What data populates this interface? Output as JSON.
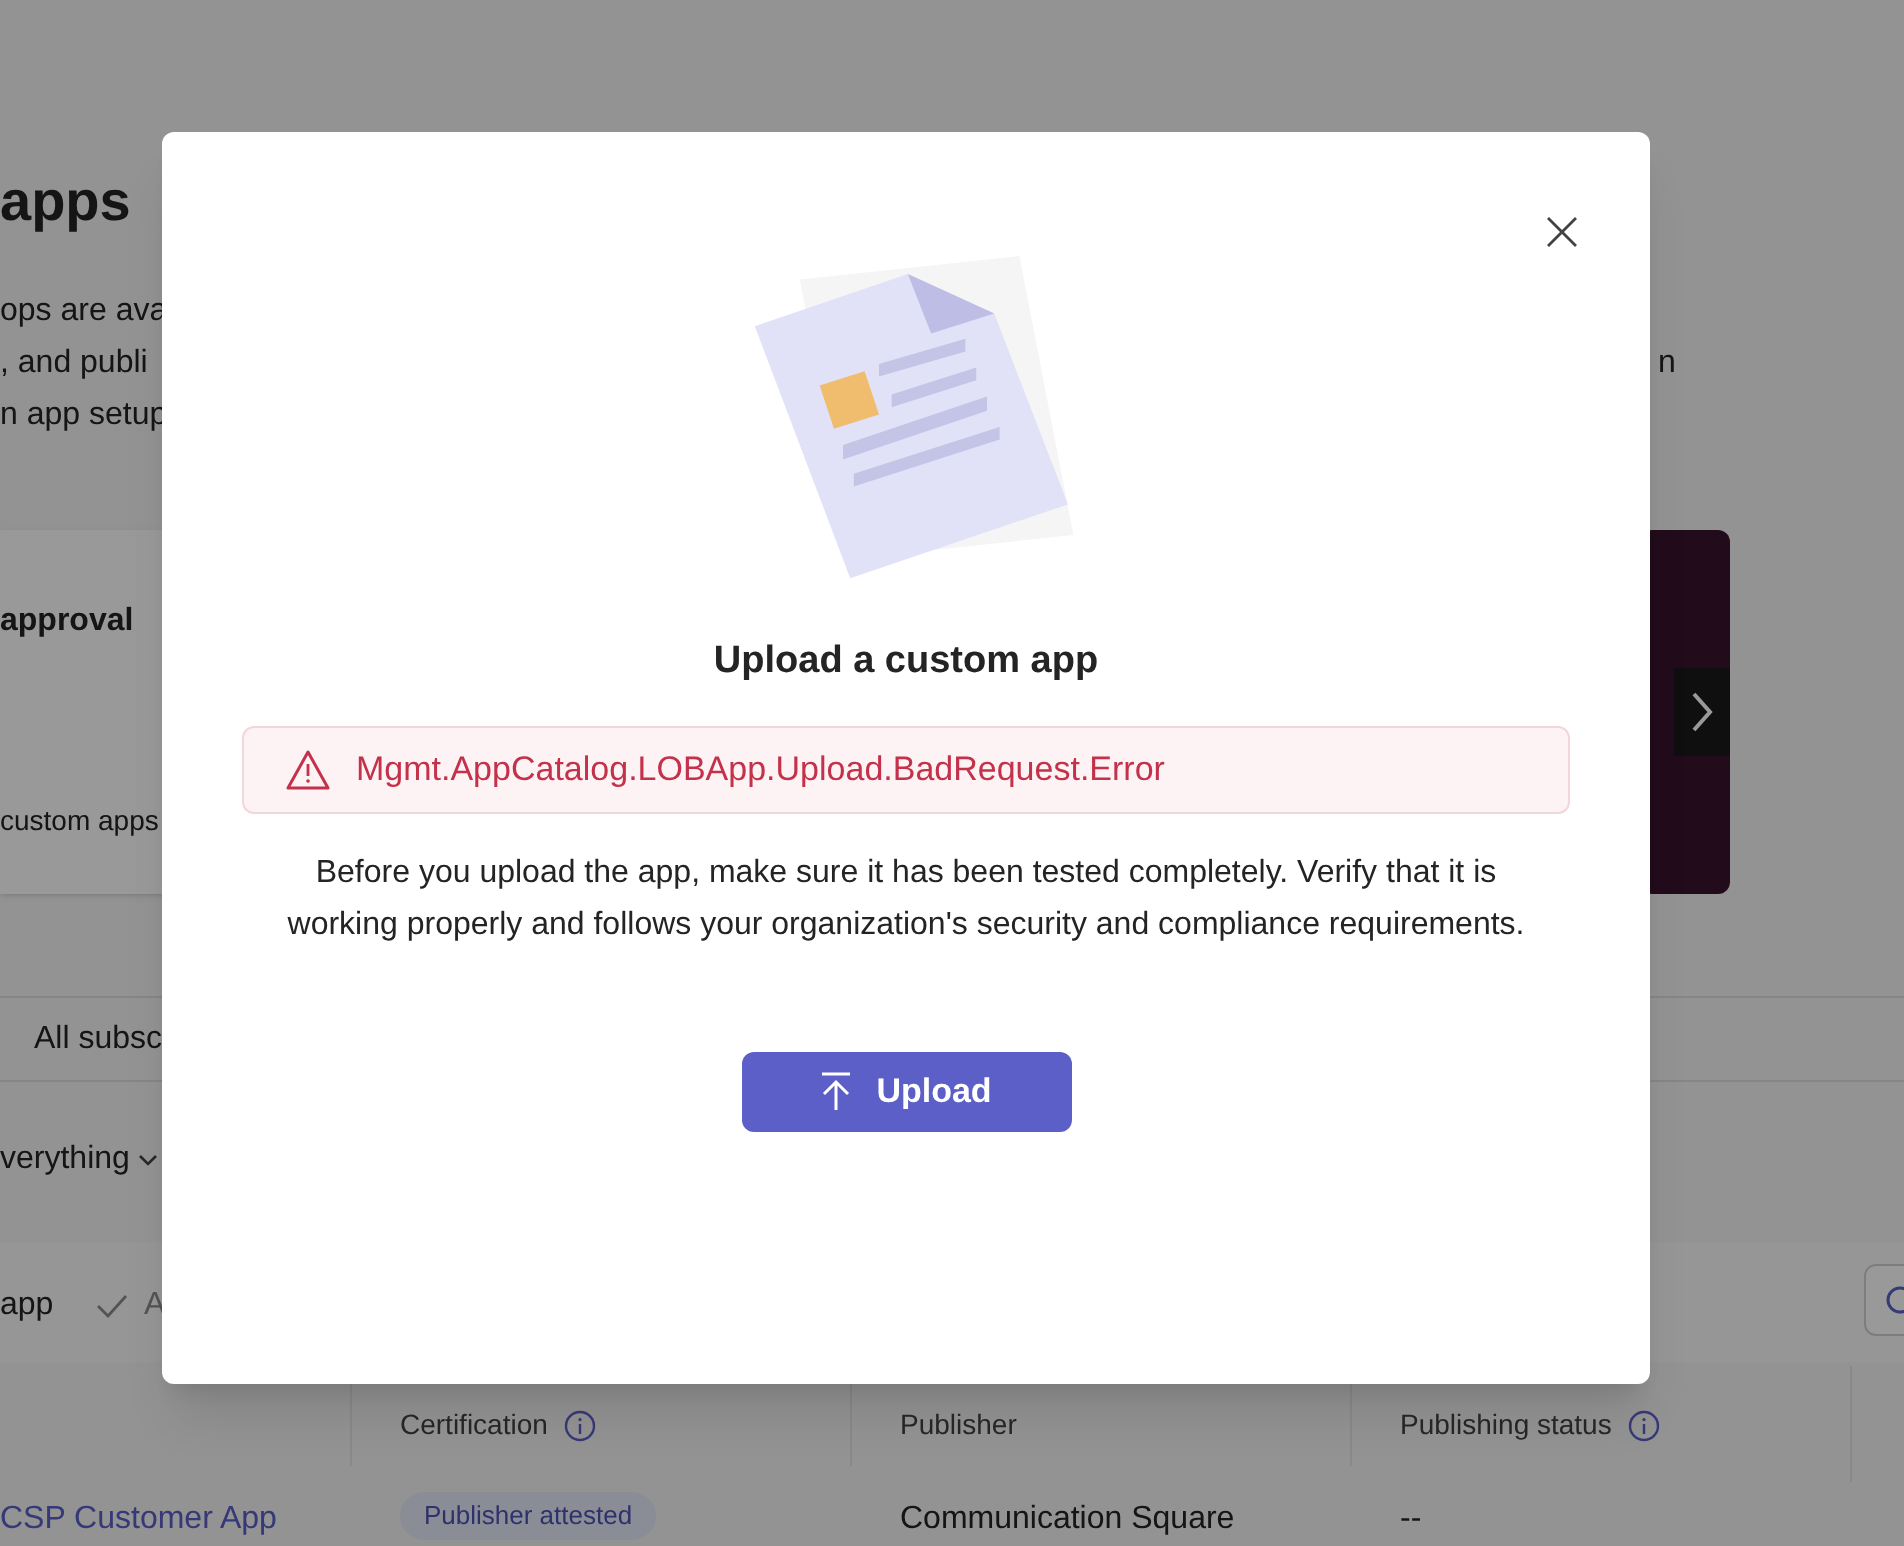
{
  "page": {
    "heading": "apps",
    "description_lines": [
      "ops are ava",
      ", and publi",
      "n app setup"
    ],
    "description_right": "n",
    "card": {
      "title": "approval",
      "text": "custom apps"
    },
    "tab": "All subsc",
    "filter": "verything",
    "toolbar": {
      "add": "app",
      "approve": "A"
    },
    "table": {
      "columns": [
        {
          "label": "Certification",
          "info": true
        },
        {
          "label": "Publisher",
          "info": false
        },
        {
          "label": "Publishing status",
          "info": true
        }
      ],
      "rows": [
        {
          "name": "CSP Customer App",
          "certification": "Publisher attested",
          "publisher": "Communication Square",
          "status": "--"
        }
      ]
    }
  },
  "dialog": {
    "title": "Upload a custom app",
    "error": "Mgmt.AppCatalog.LOBApp.Upload.BadRequest.Error",
    "message": "Before you upload the app, make sure it has been tested completely. Verify that it is working properly and follows your organization's security and compliance requirements.",
    "button": "Upload"
  }
}
